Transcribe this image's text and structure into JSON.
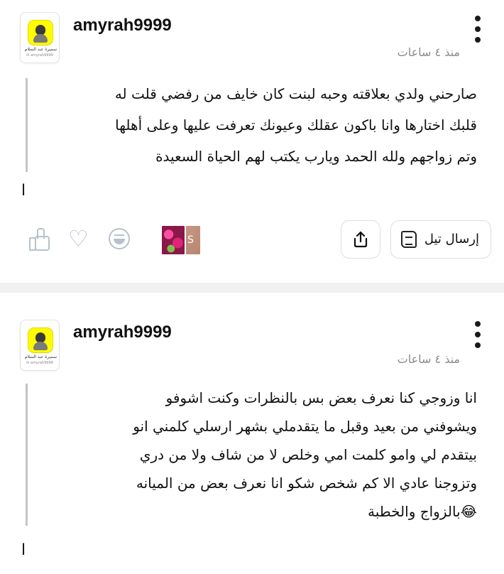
{
  "posts": [
    {
      "username": "amyrah9999",
      "time": "منذ ٤ ساعات",
      "avatar_caption": "سميرة عبد السلام 🌿",
      "avatar_sub": "amyrah9999 ✉",
      "lines": [
        "صارحني ولدي بعلاقته وحبه لبنت كان خايف من رفضي قلت له",
        "قلبك اختارها وانا باكون عقلك وعيونك تعرفت عليها وعلى أهلها",
        "وتم زواجهم ولله الحمد ويارب يكتب لهم الحياة السعيدة"
      ],
      "tail": "ا",
      "send_label": "إرسال تيل",
      "thumb_letter": "S"
    },
    {
      "username": "amyrah9999",
      "time": "منذ ٤ ساعات",
      "avatar_caption": "سميرة عبد السلام 🌿",
      "avatar_sub": "amyrah9999 ✉",
      "lines": [
        "انا وزوجي كنا نعرف بعض بس بالنظرات وكنت اشوفو",
        "ويشوفني من بعيد وقبل ما يتقدملي بشهر ارسلي كلمني انو",
        "بيتقدم لي وامو كلمت امي وخلص لا من شاف ولا من دري",
        "وتزوجنا عادي الا كم شخص شكو انا نعرف بعض من الميانه",
        "😂بالزواج والخطبة"
      ],
      "tail": "ا"
    }
  ],
  "icons": {
    "more": "more-vertical-icon",
    "like": "thumbs-up-icon",
    "love": "heart-icon",
    "laugh": "laughing-face-icon",
    "share": "share-upload-icon",
    "send": "scroll-icon"
  },
  "colors": {
    "icon_grey": "#b6c1cc",
    "divider": "#f1f1f1",
    "snap_yellow": "#fffc00"
  }
}
